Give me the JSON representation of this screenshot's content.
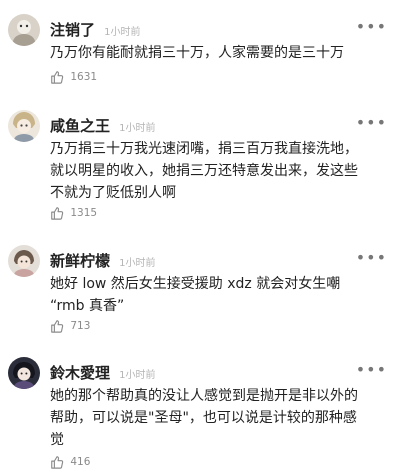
{
  "comments": [
    {
      "username": "注销了",
      "time": "1小时前",
      "lines": [
        "乃万你有能耐就捐三十万，人家需要的是三十万"
      ],
      "likes": "1631",
      "more": "•••"
    },
    {
      "username": "咸鱼之王",
      "time": "1小时前",
      "lines": [
        "乃万捐三十万我光速闭嘴，捐三百万我直接洗地，",
        "就以明星的收入，她捐三万还特意发出来，发这些",
        "不就为了贬低别人啊"
      ],
      "likes": "1315",
      "more": "•••"
    },
    {
      "username": "新鲜柠檬",
      "time": "1小时前",
      "lines": [
        "她好 low 然后女生接受援助 xdz 就会对女生嘲",
        "“rmb 真香”"
      ],
      "likes": "713",
      "more": "•••"
    },
    {
      "username": "鈴木愛理",
      "time": "1小时前",
      "lines": [
        "她的那个帮助真的没让人感觉到是抛开是非以外的",
        "帮助，可以说是\"圣母\"，也可以说是计较的那种感",
        "觉"
      ],
      "likes": "416",
      "more": "•••"
    }
  ],
  "icons": {
    "avatar": "avatar-icon",
    "like": "thumbs-up-icon",
    "more": "more-options-icon"
  },
  "colors": {
    "text": "#222222",
    "meta": "#b4b4b4",
    "count": "#8a8a8a"
  }
}
